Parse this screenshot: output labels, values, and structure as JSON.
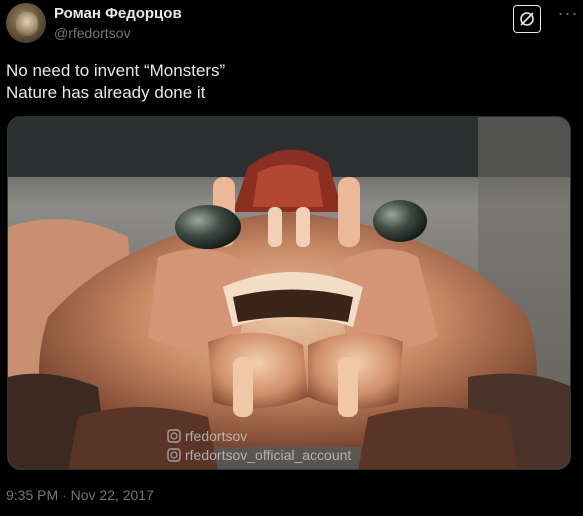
{
  "author": {
    "display_name": "Роман Федорцов",
    "handle": "@rfedortsov",
    "avatar_icon": "user-avatar"
  },
  "tweet": {
    "text_lines": [
      "No need to invent “Monsters”",
      "Nature has already done it"
    ],
    "media": {
      "description_icon": "crab-photo",
      "watermark_lines": [
        "rfedortsov",
        "rfedortsov_official_account"
      ]
    },
    "timestamp": "9:35 PM · Nov 22, 2017"
  },
  "header_actions": {
    "grok_icon": "grok-icon",
    "more_icon": "more-icon"
  },
  "colors": {
    "background": "#000000",
    "text_primary": "#e7e9ea",
    "text_secondary": "#71767b"
  }
}
